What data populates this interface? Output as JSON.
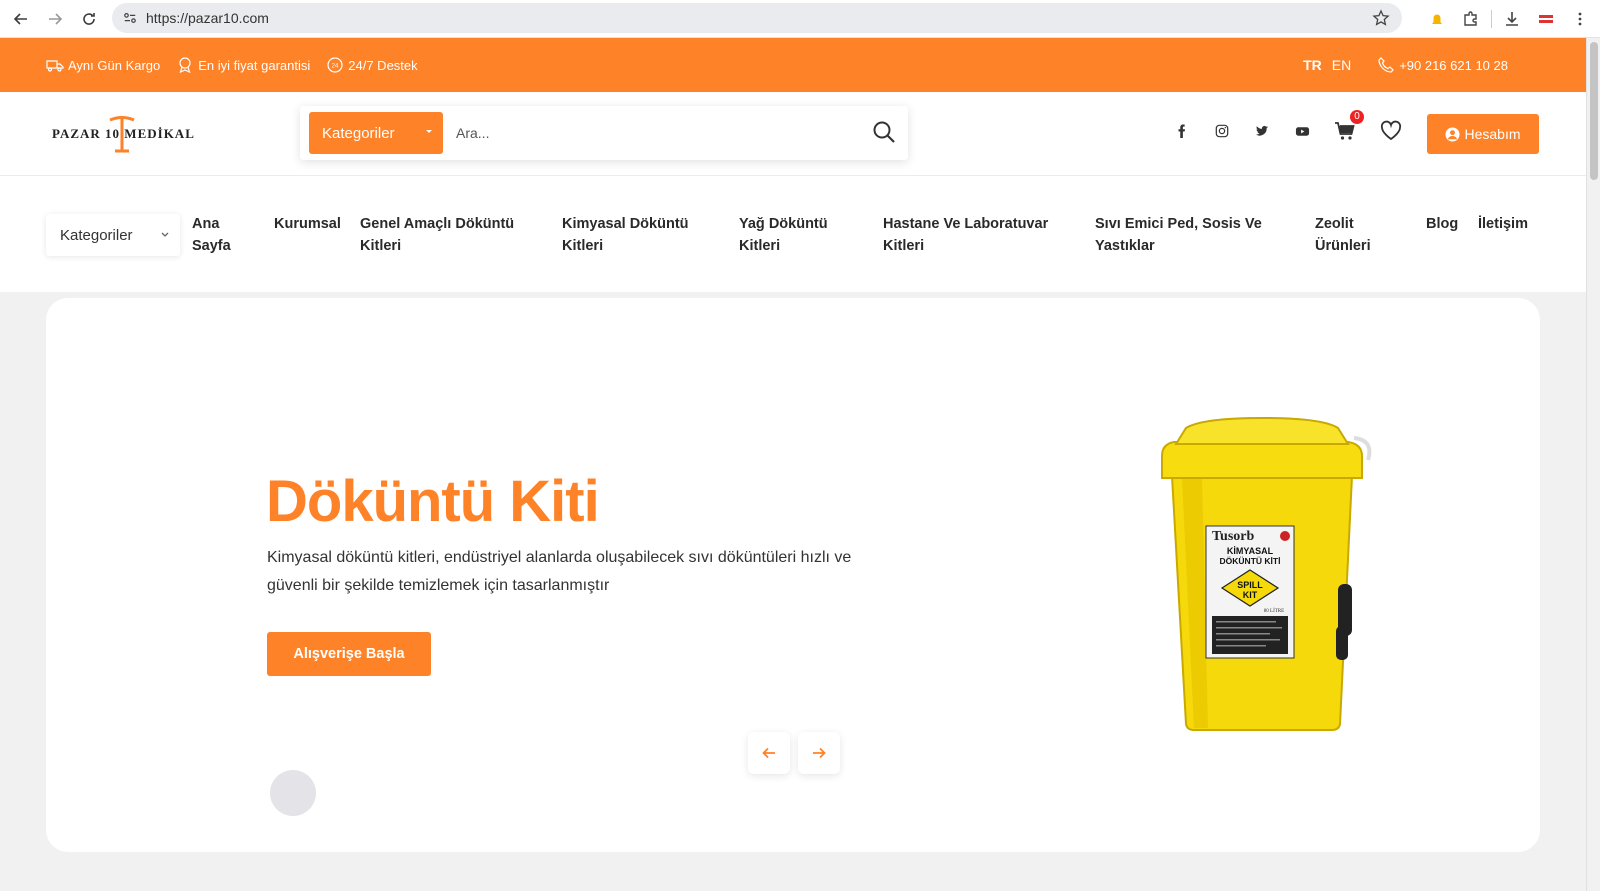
{
  "browser": {
    "url": "https://pazar10.com"
  },
  "topbar": {
    "features": [
      "Aynı Gün Kargo",
      "En iyi fiyat garantisi",
      "24/7 Destek"
    ],
    "lang_tr": "TR",
    "lang_en": "EN",
    "phone": "+90 216 621 10 28"
  },
  "header": {
    "logo_text": "PAZAR 10 MEDİKAL",
    "category_label": "Kategoriler",
    "search_placeholder": "Ara...",
    "cart_count": "0",
    "account_label": "Hesabım",
    "socials": [
      "facebook-icon",
      "instagram-icon",
      "twitter-icon",
      "youtube-icon"
    ]
  },
  "nav": {
    "category_label": "Kategoriler",
    "items": [
      "Ana Sayfa",
      "Kurumsal",
      "Genel Amaçlı Döküntü Kitleri",
      "Kimyasal Döküntü Kitleri",
      "Yağ Döküntü Kitleri",
      "Hastane Ve Laboratuvar Kitleri",
      "Sıvı Emici Ped, Sosis Ve Yastıklar",
      "Zeolit Ürünleri",
      "Blog",
      "İletişim"
    ]
  },
  "hero": {
    "title": "Döküntü Kiti",
    "description": "Kimyasal döküntü kitleri, endüstriyel alanlarda oluşabilecek sıvı döküntüleri hızlı ve güvenli bir şekilde temizlemek için tasarlanmıştır",
    "cta": "Alışverişe Başla",
    "product_label_brand": "Tusorb",
    "product_label_line1": "KİMYASAL",
    "product_label_line2": "DÖKÜNTÜ KİTİ",
    "product_badge_line1": "SPILL",
    "product_badge_line2": "KIT",
    "product_size": "80 LİTRE"
  },
  "colors": {
    "accent": "#fe8227",
    "badge": "#e22222",
    "product_yellow": "#f5d90a"
  }
}
